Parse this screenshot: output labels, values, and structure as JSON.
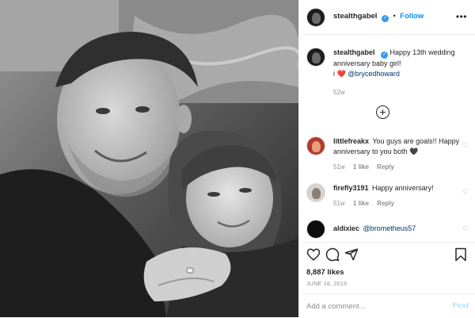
{
  "header": {
    "username": "stealthgabel",
    "verified_icon": "verified-badge-icon",
    "separator": "•",
    "follow_label": "Follow",
    "more_icon": "ellipsis-icon"
  },
  "caption": {
    "username": "stealthgabel",
    "text": "Happy 13th wedding anniversary baby girl!",
    "line2_prefix": "i",
    "heart_emoji": "❤️",
    "mention": "@brycedhoward",
    "time": "52w"
  },
  "load_more_icon": "plus-circle-icon",
  "comments": [
    {
      "username": "littlefreakx",
      "text": "You guys are goals!! Happy anniversary to you both",
      "emoji": "🖤",
      "time": "51w",
      "likes": "1 like",
      "reply": "Reply"
    },
    {
      "username": "firefly3191",
      "text": "Happy anniversary!",
      "time": "51w",
      "likes": "1 like",
      "reply": "Reply"
    },
    {
      "username": "aldixiec",
      "text": "@brometheus57"
    }
  ],
  "actions": {
    "icons": [
      "heart-icon",
      "comment-icon",
      "share-icon",
      "bookmark-icon"
    ],
    "likes": "8,887 likes",
    "date": "JUNE 18, 2019"
  },
  "add_comment": {
    "placeholder": "Add a comment...",
    "post_label": "Post"
  },
  "colors": {
    "accent": "#0095f6",
    "verified": "#3897f0",
    "muted": "#8e8e8e",
    "post_disabled": "#b2dffc"
  }
}
